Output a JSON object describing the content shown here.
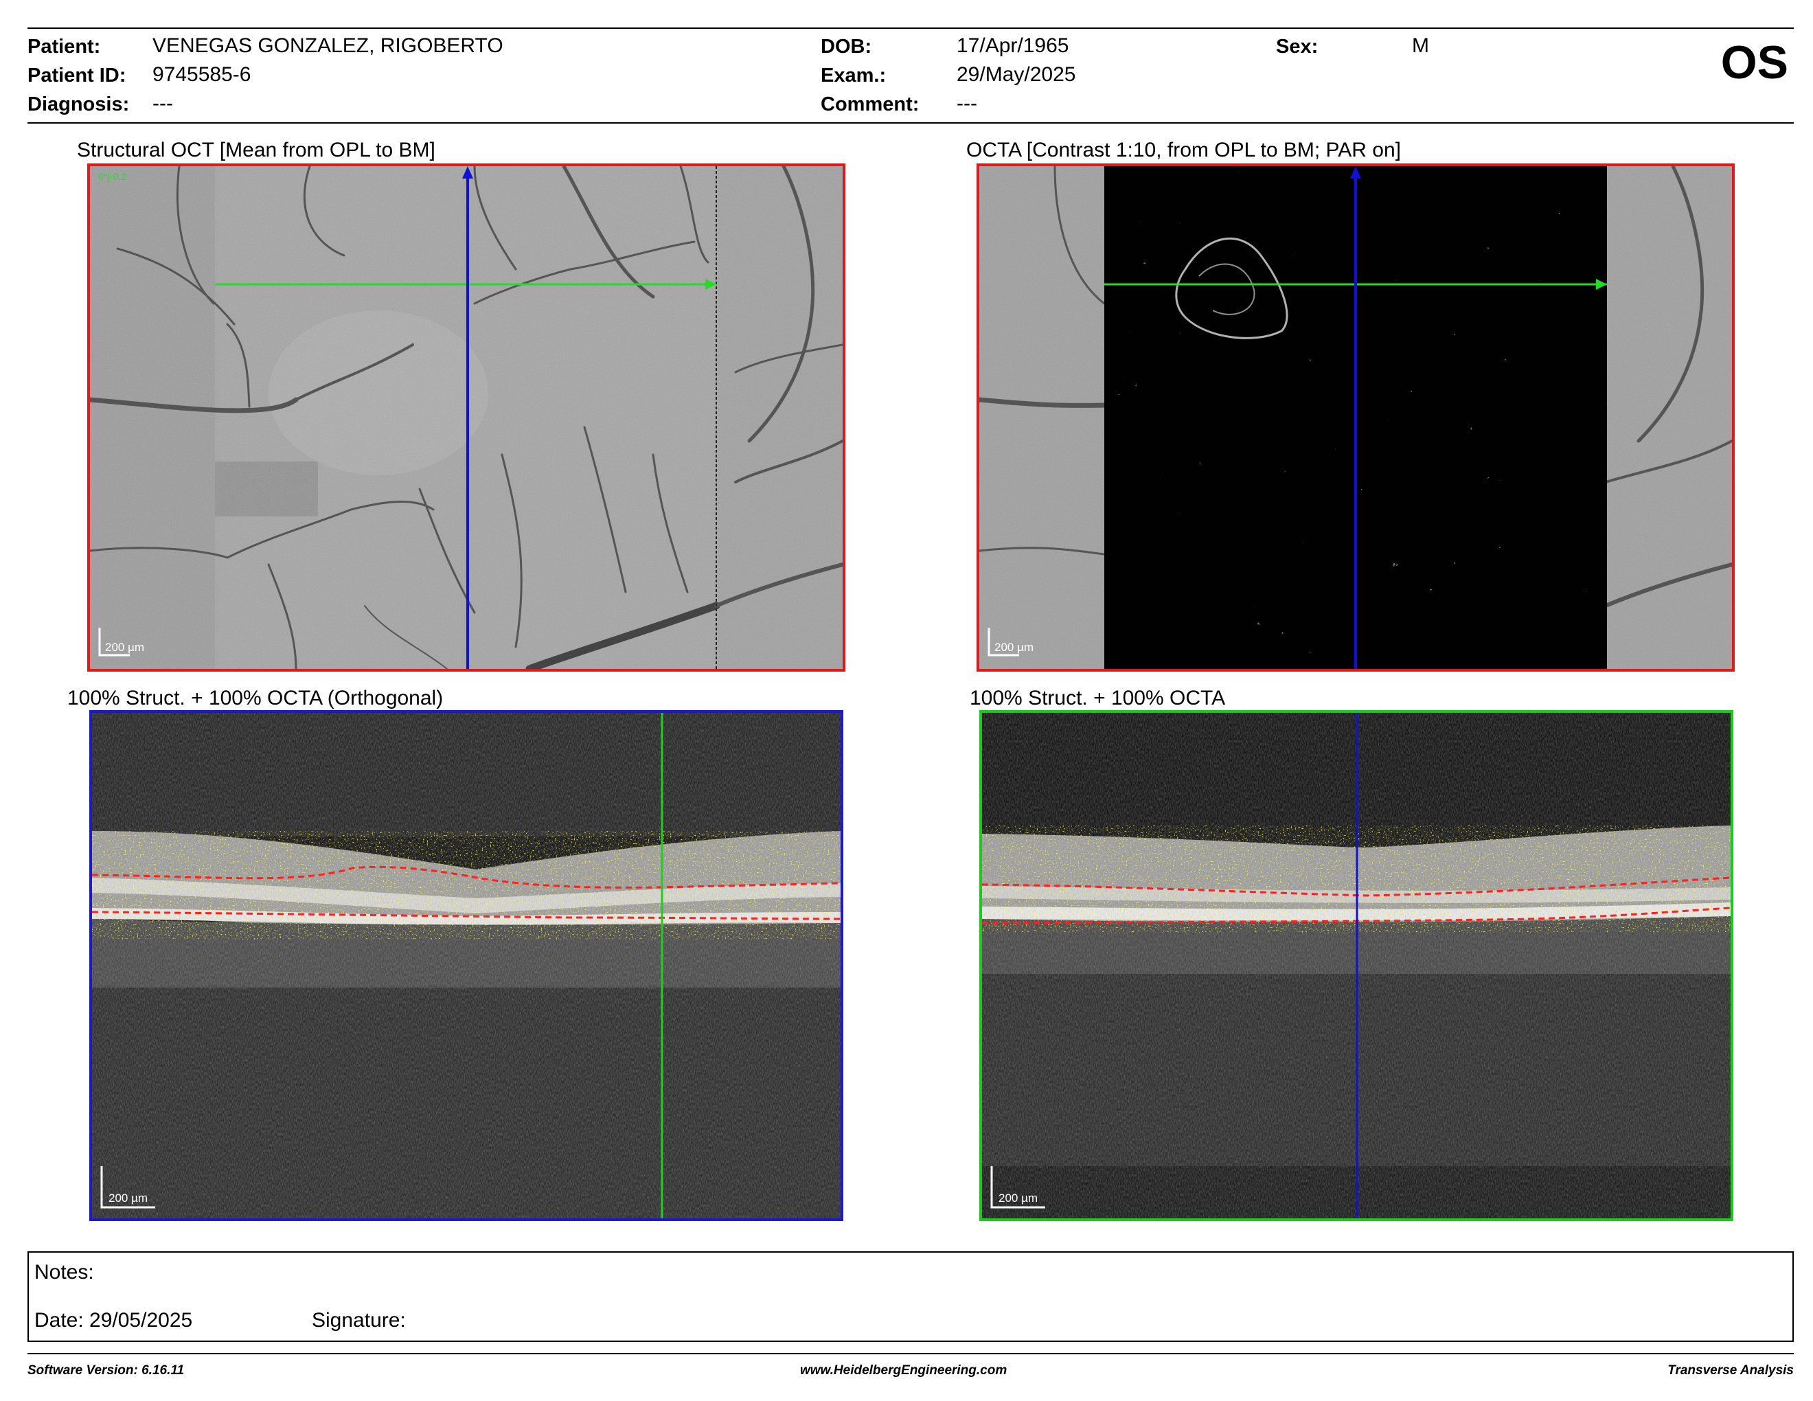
{
  "header": {
    "patient_label": "Patient:",
    "patient_value": "VENEGAS GONZALEZ, RIGOBERTO",
    "patient_id_label": "Patient ID:",
    "patient_id_value": "9745585-6",
    "diagnosis_label": "Diagnosis:",
    "diagnosis_value": "---",
    "dob_label": "DOB:",
    "dob_value": "17/Apr/1965",
    "exam_label": "Exam.:",
    "exam_value": "29/May/2025",
    "comment_label": "Comment:",
    "comment_value": "---",
    "sex_label": "Sex:",
    "sex_value": "M",
    "eye": "OS"
  },
  "panels": {
    "structural_title": "Structural OCT [Mean from OPL to BM]",
    "octa_title": "OCTA [Contrast 1:10, from OPL to BM; PAR on]",
    "orthogonal_title": "100% Struct. + 100% OCTA (Orthogonal)",
    "bscan_title": "100% Struct. + 100% OCTA",
    "scale_label": "200 µm"
  },
  "notes": {
    "notes_label": "Notes:",
    "date_label": "Date: 29/05/2025",
    "signature_label": "Signature:"
  },
  "footer": {
    "software": "Software Version: 6.16.11",
    "website": "www.HeidelbergEngineering.com",
    "analysis": "Transverse Analysis"
  },
  "colors": {
    "red_frame": "#e0191c",
    "blue_frame": "#1a1acc",
    "green_frame": "#19cc19",
    "green_arrow": "#22dd22",
    "blue_arrow": "#1010dd"
  }
}
